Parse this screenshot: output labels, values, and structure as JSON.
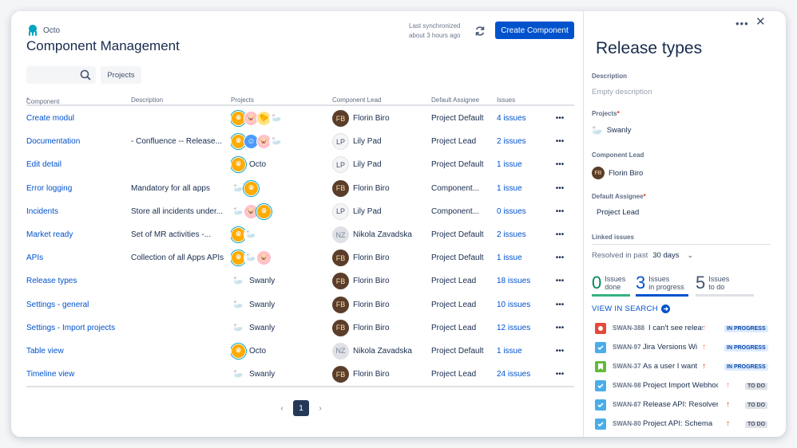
{
  "app": {
    "name": "Octo"
  },
  "page_title": "Component Management",
  "sync": {
    "line1": "Last synchronized",
    "line2": "about 3 hours ago"
  },
  "create_button": "Create Component",
  "search": {
    "placeholder": ""
  },
  "filter": {
    "projects_label": "Projects"
  },
  "columns": {
    "component": "Component",
    "description": "Description",
    "projects": "Projects",
    "lead": "Component Lead",
    "assignee": "Default Assignee",
    "issues": "Issues"
  },
  "rows": [
    {
      "name": "Create modul",
      "desc": "",
      "projects": [
        "octo",
        "pig",
        "bird",
        "swanly"
      ],
      "project_label": "",
      "lead": "Florin Biro",
      "lead_avatar": "florin",
      "assignee": "Project Default",
      "issues": "4 issues"
    },
    {
      "name": "Documentation",
      "desc": "- Confluence -- Release...",
      "projects": [
        "octo",
        "blue",
        "pig",
        "swanly"
      ],
      "project_label": "",
      "lead": "Lily Pad",
      "lead_avatar": "lily",
      "assignee": "Project Lead",
      "issues": "2 issues"
    },
    {
      "name": "Edit detail",
      "desc": "",
      "projects": [
        "octo"
      ],
      "project_label": "Octo",
      "lead": "Lily Pad",
      "lead_avatar": "lily",
      "assignee": "Project Default",
      "issues": "1 issue"
    },
    {
      "name": "Error logging",
      "desc": "Mandatory for all apps",
      "projects": [
        "swanly",
        "octo"
      ],
      "project_label": "",
      "lead": "Florin Biro",
      "lead_avatar": "florin",
      "assignee": "Component...",
      "issues": "1 issue"
    },
    {
      "name": "Incidents",
      "desc": "Store all incidents under...",
      "projects": [
        "swanly",
        "pig",
        "octo"
      ],
      "project_label": "",
      "lead": "Lily Pad",
      "lead_avatar": "lily",
      "assignee": "Component...",
      "issues": "0 issues"
    },
    {
      "name": "Market ready",
      "desc": "Set of MR activities -...",
      "projects": [
        "octo",
        "swanly"
      ],
      "project_label": "",
      "lead": "Nikola Zavadska",
      "lead_avatar": "nikola",
      "assignee": "Project Default",
      "issues": "2 issues"
    },
    {
      "name": "APIs",
      "desc": "Collection of all Apps APIs",
      "projects": [
        "octo",
        "swanly",
        "pig"
      ],
      "project_label": "",
      "lead": "Florin Biro",
      "lead_avatar": "florin",
      "assignee": "Project Default",
      "issues": "1 issue"
    },
    {
      "name": "Release types",
      "desc": "",
      "projects": [
        "swanly"
      ],
      "project_label": "Swanly",
      "lead": "Florin Biro",
      "lead_avatar": "florin",
      "assignee": "Project Lead",
      "issues": "18 issues"
    },
    {
      "name": "Settings - general",
      "desc": "",
      "projects": [
        "swanly"
      ],
      "project_label": "Swanly",
      "lead": "Florin Biro",
      "lead_avatar": "florin",
      "assignee": "Project Lead",
      "issues": "10 issues"
    },
    {
      "name": "Settings - Import projects",
      "desc": "",
      "projects": [
        "swanly"
      ],
      "project_label": "Swanly",
      "lead": "Florin Biro",
      "lead_avatar": "florin",
      "assignee": "Project Lead",
      "issues": "12 issues"
    },
    {
      "name": "Table view",
      "desc": "",
      "projects": [
        "octo"
      ],
      "project_label": "Octo",
      "lead": "Nikola Zavadska",
      "lead_avatar": "nikola",
      "assignee": "Project Default",
      "issues": "1 issue"
    },
    {
      "name": "Timeline view",
      "desc": "",
      "projects": [
        "swanly"
      ],
      "project_label": "Swanly",
      "lead": "Florin Biro",
      "lead_avatar": "florin",
      "assignee": "Project Lead",
      "issues": "24 issues"
    }
  ],
  "pagination": {
    "current": "1"
  },
  "panel": {
    "title": "Release types",
    "description_label": "Description",
    "description_placeholder": "Empty description",
    "projects_label": "Projects",
    "project_value": "Swanly",
    "lead_label": "Component Lead",
    "lead_value": "Florin Biro",
    "assignee_label": "Default Assignee",
    "assignee_value": "Project Lead",
    "linked_label": "Linked issues",
    "resolved_prefix": "Resolved in past",
    "resolved_days": "30 days",
    "stats": {
      "done": {
        "num": "0",
        "l1": "Issues",
        "l2": "done"
      },
      "progress": {
        "num": "3",
        "l1": "Issues",
        "l2": "in progress"
      },
      "todo": {
        "num": "5",
        "l1": "Issues",
        "l2": "to do"
      }
    },
    "view_search": "VIEW IN SEARCH",
    "issues": [
      {
        "type": "bug",
        "key": "SWAN-388",
        "summary": "I can't see release",
        "prio": "orange",
        "status": "IN PROGRESS",
        "status_kind": "inprog"
      },
      {
        "type": "task",
        "key": "SWAN-97",
        "summary": "Jira Versions Widget",
        "prio": "orange",
        "status": "IN PROGRESS",
        "status_kind": "inprog"
      },
      {
        "type": "story",
        "key": "SWAN-37",
        "summary": "As a user I want to",
        "prio": "red",
        "status": "IN PROGRESS",
        "status_kind": "inprog"
      },
      {
        "type": "task",
        "key": "SWAN-98",
        "summary": "Project Import Webhook",
        "prio": "orange",
        "status": "TO DO",
        "status_kind": "todo"
      },
      {
        "type": "task",
        "key": "SWAN-87",
        "summary": "Release API: Resolver",
        "prio": "red",
        "status": "TO DO",
        "status_kind": "todo"
      },
      {
        "type": "task",
        "key": "SWAN-80",
        "summary": "Project API: Schema",
        "prio": "red",
        "status": "TO DO",
        "status_kind": "todo"
      }
    ]
  },
  "colors": {
    "accent": "#0052cc",
    "done": "#36b37e",
    "prio_orange": "#ff7452",
    "prio_red": "#de350b"
  }
}
